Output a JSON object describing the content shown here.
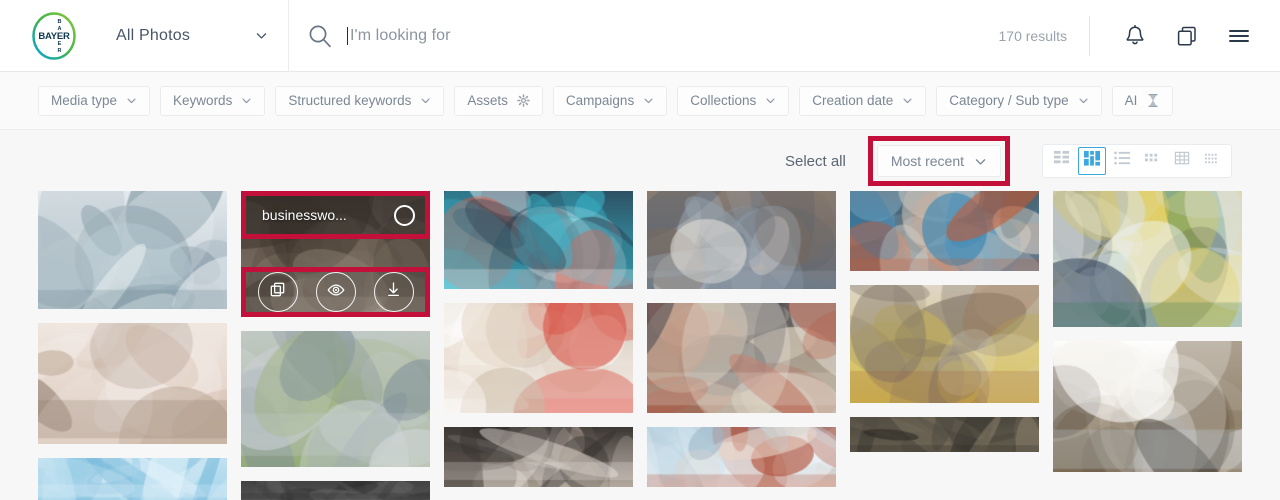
{
  "header": {
    "logo_alt": "Bayer",
    "scope": {
      "label": "All Photos",
      "icon": "chevron-down-icon"
    },
    "search": {
      "placeholder": "I'm looking for",
      "value": "",
      "icon": "search-icon"
    },
    "results_text": "170 results",
    "icons": [
      {
        "name": "notifications-bell-icon",
        "label": "Notifications"
      },
      {
        "name": "collections-copy-icon",
        "label": "Collections"
      },
      {
        "name": "hamburger-menu-icon",
        "label": "Menu"
      }
    ]
  },
  "filters": [
    {
      "label": "Media type",
      "trailing": "chevron-down-icon"
    },
    {
      "label": "Keywords",
      "trailing": "chevron-down-icon"
    },
    {
      "label": "Structured keywords",
      "trailing": "chevron-down-icon"
    },
    {
      "label": "Assets",
      "trailing": "gear-icon"
    },
    {
      "label": "Campaigns",
      "trailing": "chevron-down-icon"
    },
    {
      "label": "Collections",
      "trailing": "chevron-down-icon"
    },
    {
      "label": "Creation date",
      "trailing": "chevron-down-icon"
    },
    {
      "label": "Category / Sub type",
      "trailing": "chevron-down-icon"
    },
    {
      "label": "AI",
      "trailing": "hourglass-icon"
    }
  ],
  "toolbar": {
    "select_all_label": "Select all",
    "sort": {
      "value": "Most recent",
      "icon": "chevron-down-icon",
      "highlighted": true
    },
    "view_modes": [
      {
        "name": "view-mode-grid-large",
        "active": false
      },
      {
        "name": "view-mode-masonry",
        "active": true
      },
      {
        "name": "view-mode-list",
        "active": false
      },
      {
        "name": "view-mode-grid-small",
        "active": false
      },
      {
        "name": "view-mode-table",
        "active": false
      },
      {
        "name": "view-mode-compact",
        "active": false
      }
    ]
  },
  "hover_card": {
    "title": "businesswo...",
    "checkbox_checked": false,
    "actions": [
      {
        "name": "add-to-collection-icon",
        "label": "Add to collection"
      },
      {
        "name": "preview-eye-icon",
        "label": "Preview"
      },
      {
        "name": "download-icon",
        "label": "Download"
      }
    ]
  },
  "annotation": {
    "color": "#c2103a",
    "accent_blue": "#3aa7de"
  },
  "grid": {
    "columns": [
      [
        {
          "id": "c1r1",
          "h": 124,
          "kind": "lab-worker-bottling",
          "p": [
            "#cfd8dd",
            "#9fb0bb",
            "#6d8794",
            "#bfd2da",
            "#e8eef1"
          ]
        },
        {
          "id": "c1r2",
          "h": 127,
          "kind": "group-meeting-room",
          "p": [
            "#f2eae6",
            "#d7c2b4",
            "#8a7668",
            "#bba793",
            "#efe6df"
          ]
        },
        {
          "id": "c1r3",
          "h": 44,
          "kind": "blue-abstract",
          "p": [
            "#cfe7f3",
            "#9ad0e8",
            "#e6f4fb",
            "#76b9da",
            "#bfe0f0"
          ]
        }
      ],
      [
        {
          "id": "c2r1",
          "h": 132,
          "kind": "businesswoman-portrait",
          "p": [
            "#4a4036",
            "#8f8275",
            "#c6b8a8",
            "#6d6155",
            "#3c332b"
          ],
          "hovered": true
        },
        {
          "id": "c2r2",
          "h": 142,
          "kind": "family-walkway",
          "p": [
            "#4f6b3c",
            "#9fb57f",
            "#c9cfd4",
            "#7f8f99",
            "#d6dade"
          ]
        },
        {
          "id": "c2r3",
          "h": 20,
          "kind": "dark-strip",
          "p": [
            "#3a3a3a",
            "#5a5a5a",
            "#2c2c2c",
            "#6a6a6a",
            "#444"
          ]
        }
      ],
      [
        {
          "id": "c3r1",
          "h": 98,
          "kind": "online-medical-class",
          "p": [
            "#3bbfd4",
            "#35b3c8",
            "#ffffff",
            "#e8543f",
            "#2c3e50"
          ]
        },
        {
          "id": "c3r2",
          "h": 110,
          "kind": "doctor-hands-care",
          "p": [
            "#f7f1e8",
            "#ffffff",
            "#e3d5c6",
            "#d94a3d",
            "#c9b9a5"
          ]
        },
        {
          "id": "c3r3",
          "h": 60,
          "kind": "classroom-health-check",
          "p": [
            "#2e2a28",
            "#b8ada0",
            "#efe9e2",
            "#6b5f57",
            "#3f3a36"
          ]
        }
      ],
      [
        {
          "id": "c4r1",
          "h": 98,
          "kind": "group-seated-four",
          "p": [
            "#d8d3cd",
            "#4a5a6b",
            "#9aa7b3",
            "#e6e2dc",
            "#7b6b5f"
          ]
        },
        {
          "id": "c4r2",
          "h": 110,
          "kind": "hands-together-circle",
          "p": [
            "#cbbda9",
            "#8b7a66",
            "#e4dcd1",
            "#b4543f",
            "#4a4a52"
          ]
        },
        {
          "id": "c4r3",
          "h": 60,
          "kind": "hands-sky",
          "p": [
            "#cfe4f0",
            "#e9d6c8",
            "#b0472f",
            "#eff6fa",
            "#9ab6c8"
          ]
        }
      ],
      [
        {
          "id": "c5r1",
          "h": 80,
          "kind": "wheelchair-basketball",
          "p": [
            "#8fb6cf",
            "#1f7fb8",
            "#c9582f",
            "#d7cfc4",
            "#4a5a63"
          ]
        },
        {
          "id": "c5r2",
          "h": 118,
          "kind": "group-therapy-yellow",
          "p": [
            "#c6b49a",
            "#d8c24a",
            "#a0643c",
            "#7e7468",
            "#e3dccf"
          ]
        },
        {
          "id": "c5r3",
          "h": 35,
          "kind": "dark-room-strip",
          "p": [
            "#3c3a33",
            "#6d6454",
            "#2a2823",
            "#8a7f6a",
            "#4e4a40"
          ]
        }
      ],
      [
        {
          "id": "c6r1",
          "h": 136,
          "kind": "hospital-corridor-staff",
          "p": [
            "#eef2f5",
            "#d9e1e7",
            "#2f7a4e",
            "#2b3a55",
            "#e3c93f"
          ]
        },
        {
          "id": "c6r2",
          "h": 131,
          "kind": "office-handshake",
          "p": [
            "#efe9df",
            "#7b6a50",
            "#c8d6e2",
            "#4a443c",
            "#ffffff"
          ]
        }
      ]
    ]
  }
}
